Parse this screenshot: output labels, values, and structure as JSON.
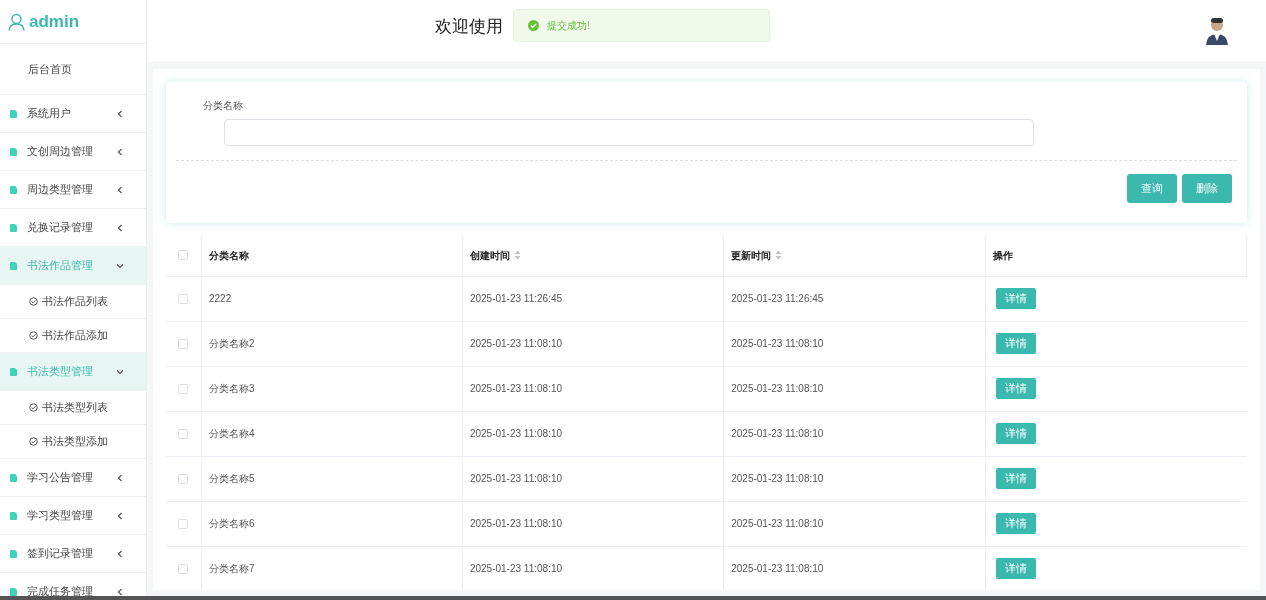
{
  "sidebar": {
    "user": "admin",
    "home": "后台首页",
    "items": [
      {
        "label": "系统用户",
        "expanded": false
      },
      {
        "label": "文创周边管理",
        "expanded": false
      },
      {
        "label": "周边类型管理",
        "expanded": false
      },
      {
        "label": "兑换记录管理",
        "expanded": false
      },
      {
        "label": "书法作品管理",
        "expanded": true,
        "children": [
          {
            "label": "书法作品列表"
          },
          {
            "label": "书法作品添加"
          }
        ]
      },
      {
        "label": "书法类型管理",
        "expanded": true,
        "children": [
          {
            "label": "书法类型列表"
          },
          {
            "label": "书法类型添加"
          }
        ]
      },
      {
        "label": "学习公告管理",
        "expanded": false
      },
      {
        "label": "学习类型管理",
        "expanded": false
      },
      {
        "label": "签到记录管理",
        "expanded": false
      },
      {
        "label": "完成任务管理",
        "expanded": false
      }
    ]
  },
  "header": {
    "title": "欢迎使用"
  },
  "toast": {
    "message": "提交成功!"
  },
  "search": {
    "label": "分类名称",
    "buttons": [
      "查询",
      "删除"
    ]
  },
  "table": {
    "select_all_checked": false,
    "columns": [
      {
        "label": "分类名称",
        "sortable": false
      },
      {
        "label": "创建时间",
        "sortable": true
      },
      {
        "label": "更新时间",
        "sortable": true
      },
      {
        "label": "操作",
        "sortable": false
      }
    ],
    "rows": [
      {
        "name": "2222",
        "created": "2025-01-23 11:26:45",
        "updated": "2025-01-23 11:26:45",
        "action": "详情",
        "checked": false
      },
      {
        "name": "分类名称2",
        "created": "2025-01-23 11:08:10",
        "updated": "2025-01-23 11:08:10",
        "action": "详情",
        "checked": false
      },
      {
        "name": "分类名称3",
        "created": "2025-01-23 11:08:10",
        "updated": "2025-01-23 11:08:10",
        "action": "详情",
        "checked": false
      },
      {
        "name": "分类名称4",
        "created": "2025-01-23 11:08:10",
        "updated": "2025-01-23 11:08:10",
        "action": "详情",
        "checked": false
      },
      {
        "name": "分类名称5",
        "created": "2025-01-23 11:08:10",
        "updated": "2025-01-23 11:08:10",
        "action": "详情",
        "checked": false
      },
      {
        "name": "分类名称6",
        "created": "2025-01-23 11:08:10",
        "updated": "2025-01-23 11:08:10",
        "action": "详情",
        "checked": false
      },
      {
        "name": "分类名称7",
        "created": "2025-01-23 11:08:10",
        "updated": "2025-01-23 11:08:10",
        "action": "详情",
        "checked": false
      }
    ]
  }
}
